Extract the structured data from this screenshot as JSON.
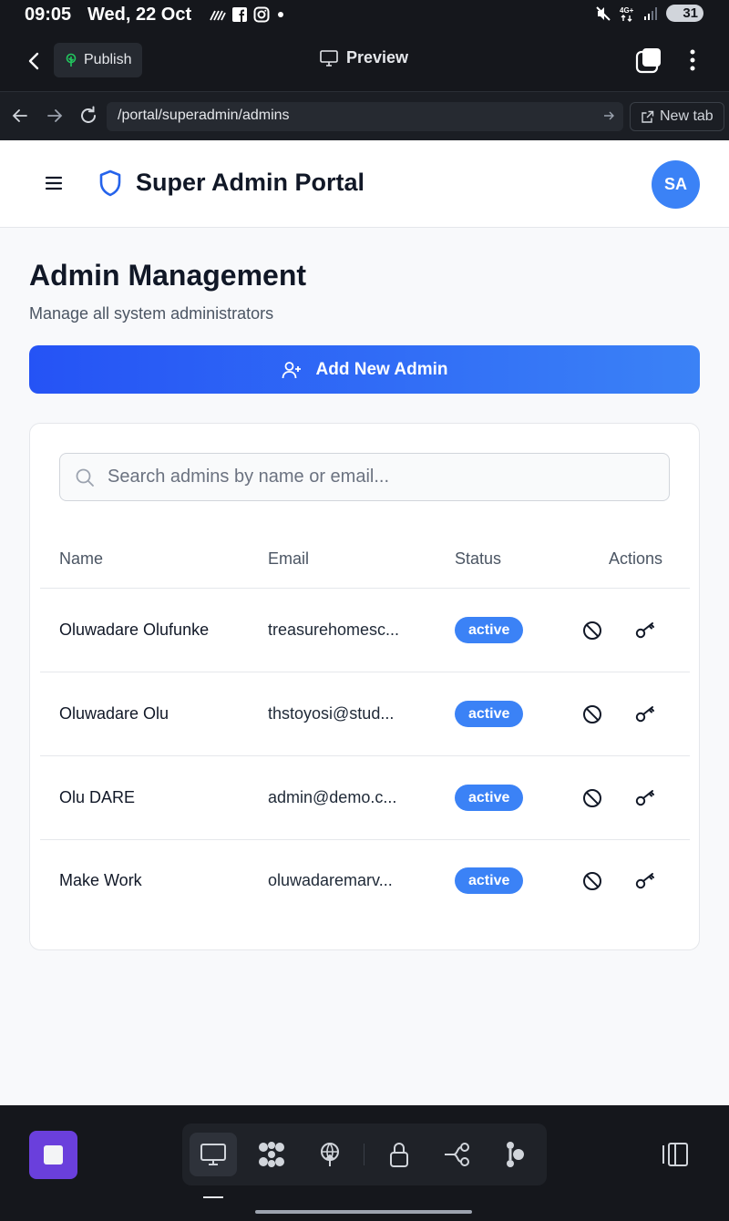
{
  "status_bar": {
    "time": "09:05",
    "date": "Wed, 22 Oct",
    "battery": "31",
    "icons": [
      "signal-lines-icon",
      "facebook-icon",
      "instagram-icon",
      "dot-icon",
      "mute-icon",
      "4g-icon",
      "cell-signal-icon",
      "battery-icon"
    ]
  },
  "app_bar": {
    "publish_label": "Publish",
    "preview_label": "Preview"
  },
  "browser": {
    "url": "/portal/superadmin/admins",
    "new_tab_label": "New tab"
  },
  "header": {
    "title": "Super Admin Portal",
    "avatar_initials": "SA"
  },
  "main": {
    "title": "Admin Management",
    "subtitle": "Manage all system administrators",
    "add_button_label": "Add New Admin"
  },
  "search": {
    "placeholder": "Search admins by name or email...",
    "value": ""
  },
  "table": {
    "columns": [
      "Name",
      "Email",
      "Status",
      "Actions"
    ],
    "rows": [
      {
        "name": "Oluwadare Olufunke",
        "email": "treasurehomesc...",
        "status": "active"
      },
      {
        "name": "Oluwadare Olu",
        "email": "thstoyosi@stud...",
        "status": "active"
      },
      {
        "name": "Olu DARE",
        "email": "admin@demo.c...",
        "status": "active"
      },
      {
        "name": "Make Work",
        "email": "oluwadaremarv...",
        "status": "active"
      }
    ]
  },
  "colors": {
    "accent": "#3b82f6",
    "button_gradient_start": "#2553f5",
    "stop_button": "#6a3fdc",
    "dark_chrome": "#15171c"
  },
  "bottom_toolbar": {
    "tools": [
      "preview-desktop-icon",
      "components-icon",
      "deploy-icon",
      "lock-icon",
      "workflow-icon",
      "agent-icon"
    ]
  }
}
